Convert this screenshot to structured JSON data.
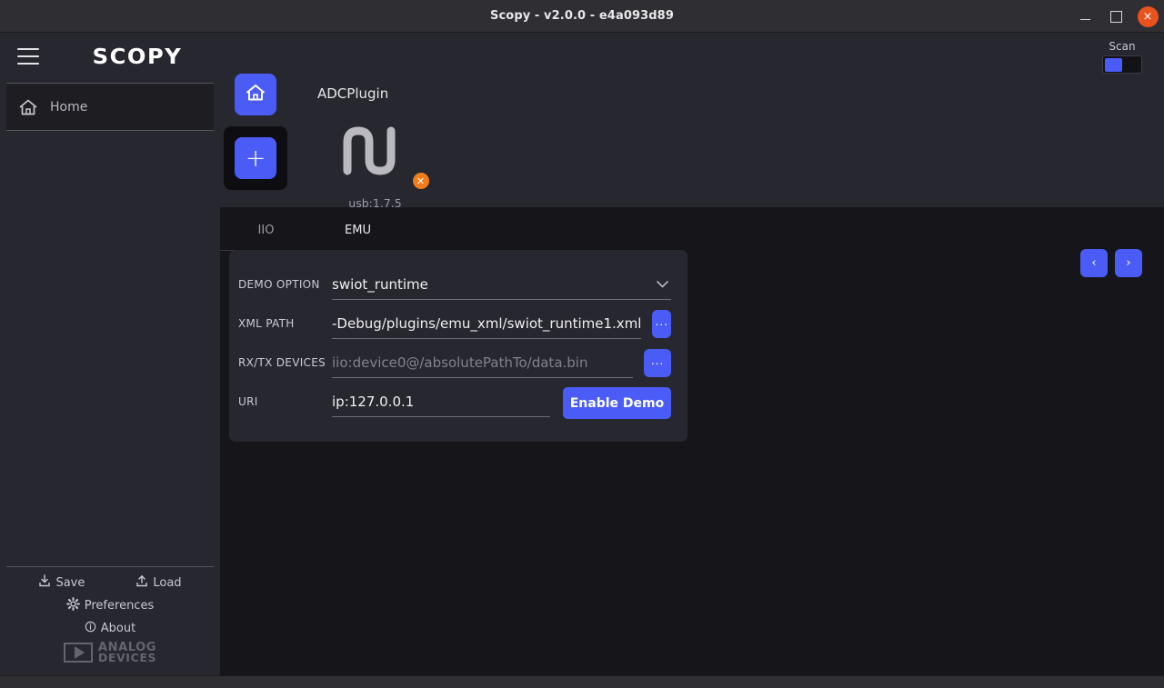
{
  "window": {
    "title": "Scopy - v2.0.0 - e4a093d89",
    "minimize_icon": "minimize-icon",
    "maximize_icon": "maximize-icon",
    "close_icon": "close-icon",
    "close_glyph": "×"
  },
  "sidebar": {
    "menu_icon": "hamburger-menu-icon",
    "logo_text": "SCOPY",
    "items": [
      {
        "label": "Home",
        "icon": "home-icon"
      }
    ],
    "footer": {
      "save_label": "Save",
      "save_icon": "save-download-icon",
      "load_label": "Load",
      "load_icon": "load-upload-icon",
      "preferences_label": "Preferences",
      "preferences_icon": "gear-icon",
      "about_label": "About",
      "about_icon": "info-icon",
      "brand_line1": "ANALOG",
      "brand_line2": "DEVICES",
      "brand_icon": "analog-devices-logo"
    }
  },
  "header": {
    "plugin_title": "ADCPlugin",
    "scan": {
      "label": "Scan",
      "state": "off"
    }
  },
  "device_toolbar": {
    "home_button": {
      "icon": "home-icon",
      "label": ""
    },
    "add_button": {
      "icon": "plus-icon",
      "label": "+",
      "selected": true
    }
  },
  "device_card": {
    "icon": "square-wave-icon",
    "badge_glyph": "✕",
    "badge_name": "disconnect-badge-icon",
    "name": "usb:1.7.5"
  },
  "tabs": [
    {
      "id": "iio",
      "label": "IIO",
      "active": false
    },
    {
      "id": "emu",
      "label": "EMU",
      "active": true
    }
  ],
  "pager": {
    "prev_glyph": "‹",
    "next_glyph": "›",
    "prev_icon": "chevron-left-icon",
    "next_icon": "chevron-right-icon"
  },
  "form": {
    "rows": [
      {
        "label": "DEMO OPTION",
        "type": "select",
        "value": "swiot_runtime",
        "placeholder": "",
        "chevron_glyph": "⌄"
      },
      {
        "label": "XML PATH",
        "type": "text",
        "value": "-Debug/plugins/emu_xml/swiot_runtime1.xml",
        "placeholder": "",
        "browse_label": "..."
      },
      {
        "label": "RX/TX DEVICES",
        "type": "text",
        "value": "",
        "placeholder": "iio:device0@/absolutePathTo/data.bin",
        "browse_label": "..."
      },
      {
        "label": "URI",
        "type": "text",
        "value": "ip:127.0.0.1",
        "placeholder": "",
        "action_label": "Enable Demo"
      }
    ]
  },
  "colors": {
    "accent_blue": "#4a5cf5",
    "accent_orange": "#ff7200",
    "badge_orange": "#ef7d1a",
    "close_red": "#e8521f",
    "panel_bg": "#272730",
    "app_bg": "#16161a",
    "titlebar_bg": "#2e2e33"
  }
}
